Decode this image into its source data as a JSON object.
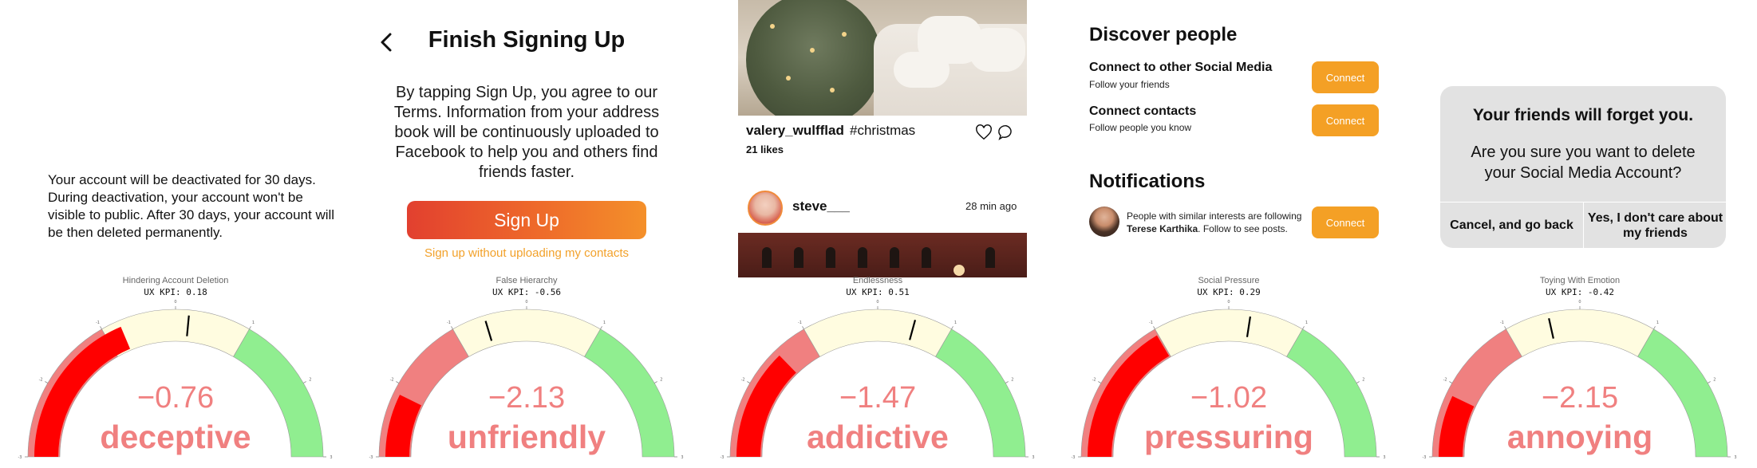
{
  "panels": [
    {
      "deactivation_text": "Your account will be deactivated for 30 days. During deactivation, your account won't be visible to public. After 30 days, your account will be then deleted permanently.",
      "gauge": {
        "title": "Hindering Account Deletion",
        "kpi": "UX KPI: 0.18",
        "kpi_value": 0.18,
        "score": "−0.76",
        "score_value": -0.76,
        "label": "deceptive"
      }
    },
    {
      "title": "Finish Signing Up",
      "body": "By tapping Sign Up, you agree to our Terms. Information from your address book will be continuously uploaded to Facebook to help you and others find friends faster.",
      "signup_button": "Sign Up",
      "signup_link": "Sign up without uploading my contacts",
      "gauge": {
        "title": "False Hierarchy",
        "kpi": "UX KPI: -0.56",
        "kpi_value": -0.56,
        "score": "−2.13",
        "score_value": -2.13,
        "label": "unfriendly"
      }
    },
    {
      "post1_user": "valery_wulfflad",
      "post1_tag": "#christmas",
      "post1_likes": "21 likes",
      "post2_user": "steve___",
      "post2_time": "28 min ago",
      "gauge": {
        "title": "Endlessness",
        "kpi": "UX KPI: 0.51",
        "kpi_value": 0.51,
        "score": "−1.47",
        "score_value": -1.47,
        "label": "addictive"
      }
    },
    {
      "discover_heading": "Discover people",
      "row1_title": "Connect to other Social Media",
      "row1_sub": "Follow your friends",
      "row2_title": "Connect contacts",
      "row2_sub": "Follow people you know",
      "connect_label": "Connect",
      "notifications_heading": "Notifications",
      "notif_text_pre": "People with similar interests are following ",
      "notif_name": "Terese Karthika",
      "notif_text_post": ". Follow to see posts.",
      "gauge": {
        "title": "Social Pressure",
        "kpi": "UX KPI: 0.29",
        "kpi_value": 0.29,
        "score": "−1.02",
        "score_value": -1.02,
        "label": "pressuring"
      }
    },
    {
      "dialog_title": "Your friends will forget you.",
      "dialog_body": "Are you sure you want to delete your Social Media Account?",
      "cancel_label": "Cancel, and go back",
      "yes_label": "Yes, I don't care about my friends",
      "gauge": {
        "title": "Toying With Emotion",
        "kpi": "UX KPI: -0.42",
        "kpi_value": -0.42,
        "score": "−2.15",
        "score_value": -2.15,
        "label": "annoying"
      }
    }
  ],
  "gauge_scale": {
    "min": -3,
    "max": 3,
    "ticks": [
      "-3",
      "-2",
      "-1",
      "0",
      "1",
      "2",
      "3"
    ]
  },
  "colors": {
    "neg_zone": "#f08080",
    "neutral_zone": "#fffce0",
    "pos_zone": "#90ee90",
    "score_bar": "#ff0000",
    "score_text": "#f08080",
    "accent_orange": "#f4a025"
  },
  "icons": {
    "back": "chevron-left-icon",
    "like": "heart-icon",
    "comment": "comment-icon"
  }
}
